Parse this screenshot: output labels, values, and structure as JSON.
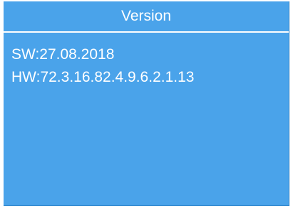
{
  "window": {
    "title": "Version"
  },
  "info": {
    "sw": "SW:27.08.2018",
    "hw": "HW:72.3.16.82.4.9.6.2.1.13"
  },
  "colors": {
    "background": "#4aa3ea",
    "text": "#ffffff",
    "divider": "#ffffff"
  }
}
